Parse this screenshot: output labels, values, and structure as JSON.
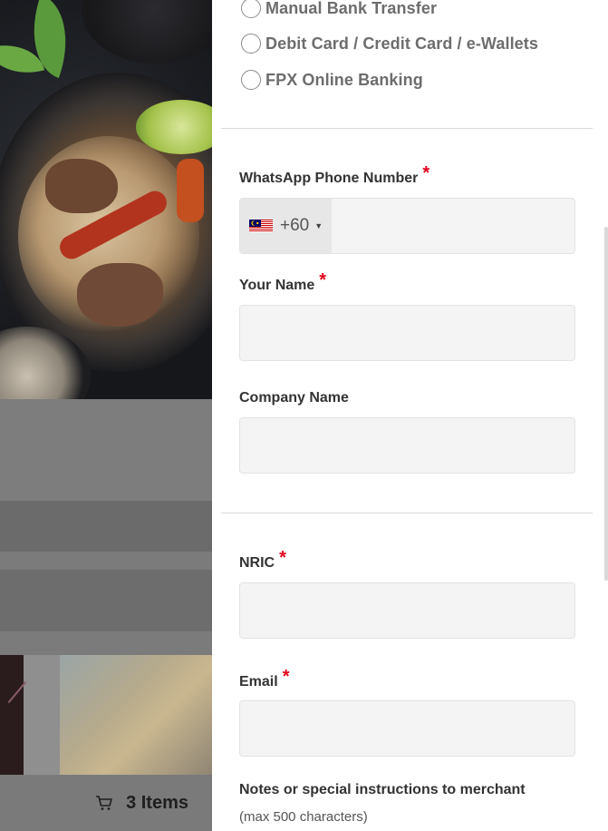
{
  "payment_options": [
    {
      "label": "Manual Bank Transfer"
    },
    {
      "label": "Debit Card / Credit Card / e-Wallets"
    },
    {
      "label": "FPX Online Banking"
    }
  ],
  "form": {
    "whatsapp": {
      "label": "WhatsApp Phone Number",
      "required_mark": "*",
      "country_code": "+60",
      "country": "Malaysia",
      "value": ""
    },
    "name": {
      "label": "Your Name",
      "required_mark": "*",
      "value": ""
    },
    "company": {
      "label": "Company Name",
      "value": ""
    },
    "nric": {
      "label": "NRIC",
      "required_mark": "*",
      "value": ""
    },
    "email": {
      "label": "Email",
      "required_mark": "*",
      "value": ""
    },
    "notes": {
      "label": "Notes or special instructions to merchant",
      "hint": "(max 500 characters)"
    }
  },
  "cart": {
    "label": "3 Items"
  },
  "colors": {
    "required": "#e3001b",
    "input_bg": "#f4f4f4",
    "text": "#333333"
  }
}
